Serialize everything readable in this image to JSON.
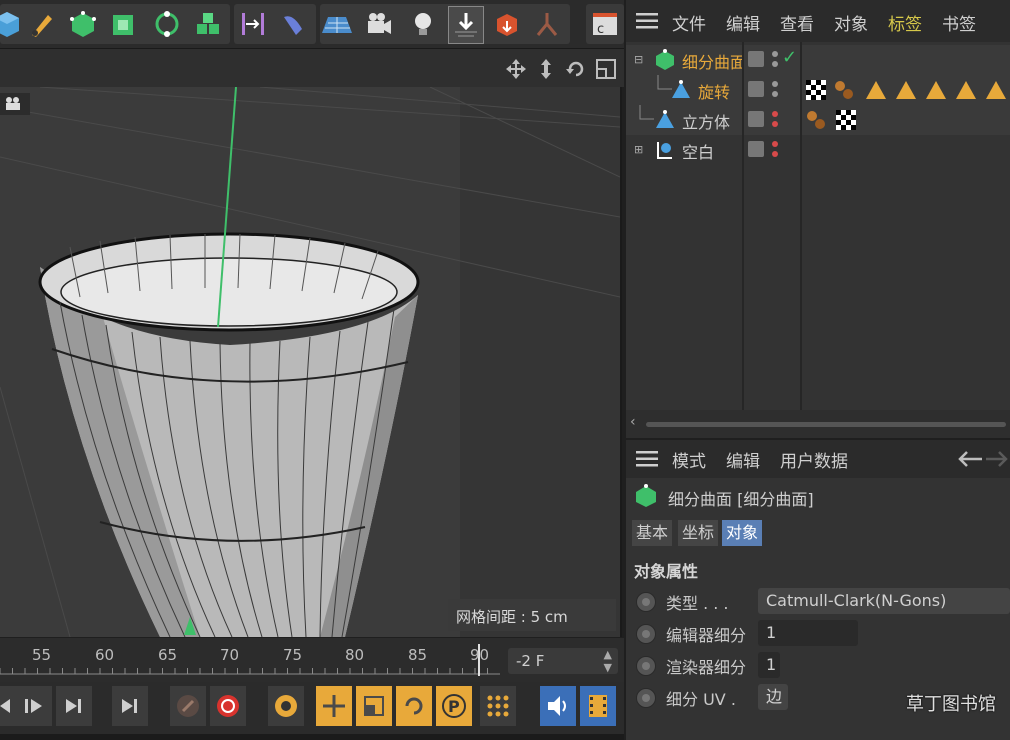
{
  "toolbar": {
    "icons": [
      "cube-icon",
      "pen-icon",
      "subdivision-icon",
      "cube-generator-icon",
      "array-icon",
      "cloner-icon",
      "symmetry-icon",
      "deformer-icon",
      "floor-icon",
      "camera-icon",
      "light-icon",
      "render-region-icon",
      "object-array-icon",
      "joint-icon",
      "render-icon"
    ]
  },
  "viewport": {
    "grid_spacing_label": "网格间距 : 5 cm"
  },
  "timeline": {
    "ticks": [
      "55",
      "60",
      "65",
      "70",
      "75",
      "80",
      "85",
      "90"
    ],
    "current_frame": "-2 F"
  },
  "object_manager": {
    "menu": [
      "文件",
      "编辑",
      "查看",
      "对象",
      "标签",
      "书签"
    ],
    "objects": [
      {
        "name": "细分曲面",
        "color": "#e8a93a"
      },
      {
        "name": "旋转",
        "color": "#e8a93a"
      },
      {
        "name": "立方体",
        "color": "#cfcfcf"
      },
      {
        "name": "空白",
        "color": "#cfcfcf"
      }
    ]
  },
  "attribute_manager": {
    "menu": [
      "模式",
      "编辑",
      "用户数据"
    ],
    "object_title": "细分曲面 [细分曲面]",
    "tabs": [
      "基本",
      "坐标",
      "对象"
    ],
    "section_title": "对象属性",
    "properties": [
      {
        "label": "类型 . . .",
        "value": "Catmull-Clark(N-Gons)"
      },
      {
        "label": "编辑器细分",
        "value": "1"
      },
      {
        "label": "渲染器细分",
        "value": "1"
      },
      {
        "label": "细分 UV .",
        "value": "边"
      }
    ]
  },
  "watermark": "草丁图书馆",
  "colors": {
    "accent": "#e8a93a",
    "active_tab": "#5a7fb5",
    "axis_green": "#3fbf6a"
  }
}
